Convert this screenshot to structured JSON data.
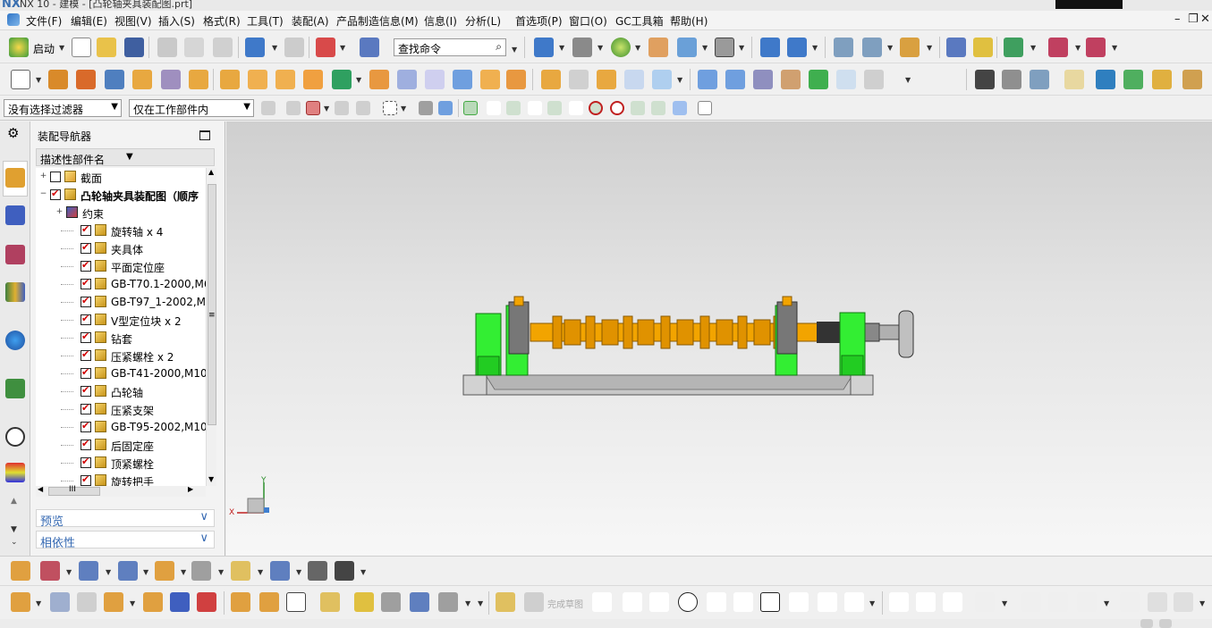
{
  "window": {
    "title": "NX 10 - 建模 - [凸轮轴夹具装配图.prt]"
  },
  "menu": {
    "items": [
      "文件(F)",
      "编辑(E)",
      "视图(V)",
      "插入(S)",
      "格式(R)",
      "工具(T)",
      "装配(A)",
      "产品制造信息(M)",
      "信息(I)",
      "分析(L)",
      "首选项(P)",
      "窗口(O)",
      "GC工具箱",
      "帮助(H)"
    ]
  },
  "toolbar": {
    "start_label": "启动",
    "search_placeholder": "查找命令"
  },
  "selection_bar": {
    "filter_value": "没有选择过滤器",
    "scope_value": "仅在工作部件内"
  },
  "navigator": {
    "title": "装配导航器",
    "column_header": "描述性部件名",
    "tree": [
      {
        "label": "截面",
        "level": 0,
        "checked": false,
        "expander": "+",
        "folder": true
      },
      {
        "label": "凸轮轴夹具装配图（顺序",
        "level": 0,
        "checked": true,
        "expander": "−",
        "bold": true
      },
      {
        "label": "约束",
        "level": 1,
        "checked": null,
        "expander": "+",
        "constraint": true
      },
      {
        "label": "旋转轴 x 4",
        "level": 2,
        "checked": true
      },
      {
        "label": "夹具体",
        "level": 2,
        "checked": true
      },
      {
        "label": "平面定位座",
        "level": 2,
        "checked": true
      },
      {
        "label": "GB-T70.1-2000,M6:",
        "level": 2,
        "checked": true
      },
      {
        "label": "GB-T97_1-2002,M6",
        "level": 2,
        "checked": true
      },
      {
        "label": "V型定位块 x 2",
        "level": 2,
        "checked": true
      },
      {
        "label": "钻套",
        "level": 2,
        "checked": true
      },
      {
        "label": "压紧螺栓 x 2",
        "level": 2,
        "checked": true
      },
      {
        "label": "GB-T41-2000,M10x",
        "level": 2,
        "checked": true
      },
      {
        "label": "凸轮轴",
        "level": 2,
        "checked": true
      },
      {
        "label": "压紧支架",
        "level": 2,
        "checked": true
      },
      {
        "label": "GB-T95-2002,M10",
        "level": 2,
        "checked": true
      },
      {
        "label": "后固定座",
        "level": 2,
        "checked": true
      },
      {
        "label": "顶紧螺栓",
        "level": 2,
        "checked": true
      },
      {
        "label": "旋转把手",
        "level": 2,
        "checked": true
      }
    ],
    "hscroll_label": "III",
    "sections": [
      "预览",
      "相依性"
    ]
  },
  "viewport": {
    "axis_x": "X",
    "axis_y": "Y"
  },
  "sketch": {
    "finish_label": "完成草图"
  },
  "colors": {
    "accent_blue": "#3468b2",
    "camshaft_orange": "#f2a400",
    "support_green": "#33ee33",
    "base_gray": "#c8c8c8"
  }
}
